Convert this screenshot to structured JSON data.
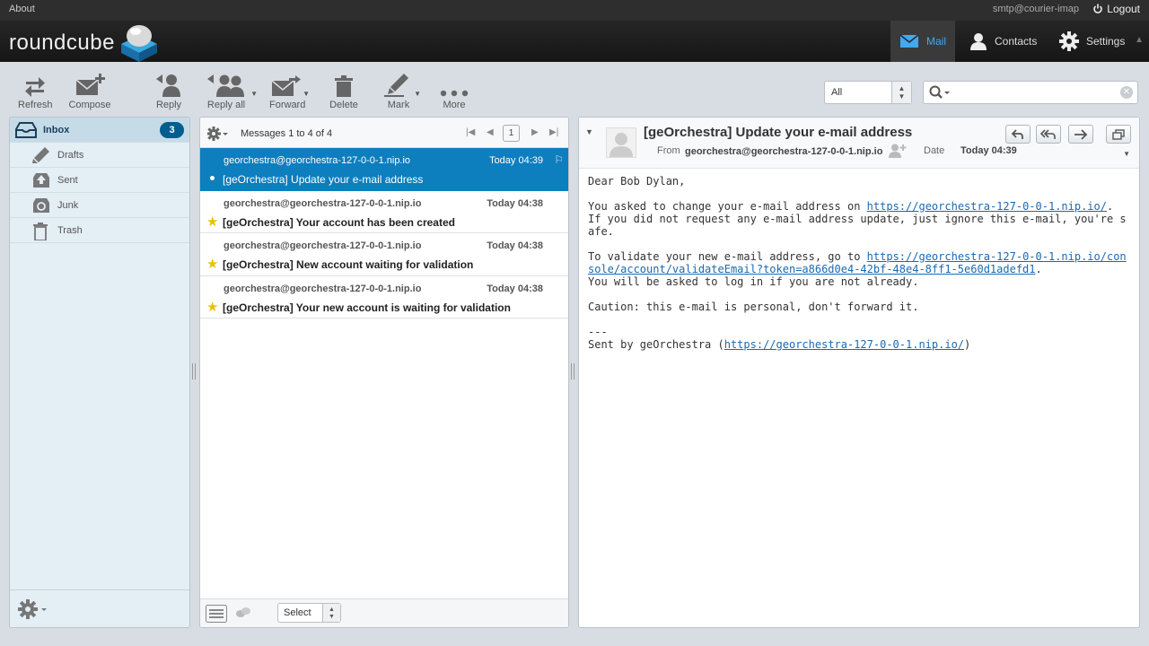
{
  "topline": {
    "about": "About",
    "user": "smtp@courier-imap",
    "logout": "Logout"
  },
  "header": {
    "logo": "roundcube",
    "nav": [
      {
        "label": "Mail",
        "icon": "mail-icon",
        "active": true
      },
      {
        "label": "Contacts",
        "icon": "contacts-icon"
      },
      {
        "label": "Settings",
        "icon": "gear-icon"
      }
    ]
  },
  "toolbar": {
    "refresh": "Refresh",
    "compose": "Compose",
    "reply": "Reply",
    "reply_all": "Reply all",
    "forward": "Forward",
    "delete": "Delete",
    "mark": "Mark",
    "more": "More"
  },
  "filter": {
    "value": "All"
  },
  "search": {
    "value": ""
  },
  "folders": [
    {
      "label": "Inbox",
      "icon": "inbox-icon",
      "unread": "3"
    },
    {
      "label": "Drafts",
      "icon": "drafts-icon"
    },
    {
      "label": "Sent",
      "icon": "sent-icon"
    },
    {
      "label": "Junk",
      "icon": "junk-icon"
    },
    {
      "label": "Trash",
      "icon": "trash-icon"
    }
  ],
  "messagelist": {
    "count": "Messages 1 to 4 of 4",
    "page": "1",
    "select_label": "Select",
    "messages": [
      {
        "from": "georchestra@georchestra-127-0-0-1.nip.io",
        "date": "Today 04:39",
        "subject": "[geOrchestra] Update your e-mail address",
        "selected": true,
        "flagged": false
      },
      {
        "from": "georchestra@georchestra-127-0-0-1.nip.io",
        "date": "Today 04:38",
        "subject": "[geOrchestra] Your account has been created",
        "flagged": true
      },
      {
        "from": "georchestra@georchestra-127-0-0-1.nip.io",
        "date": "Today 04:38",
        "subject": "[geOrchestra] New account waiting for validation",
        "flagged": true
      },
      {
        "from": "georchestra@georchestra-127-0-0-1.nip.io",
        "date": "Today 04:38",
        "subject": "[geOrchestra] Your new account is waiting for validation",
        "flagged": true
      }
    ]
  },
  "preview": {
    "subject": "[geOrchestra] Update your e-mail address",
    "from_label": "From",
    "from": "georchestra@georchestra-127-0-0-1.nip.io",
    "date_label": "Date",
    "date": "Today 04:39",
    "body": {
      "greeting": "Dear Bob Dylan,",
      "p1_start": "You asked to change your e-mail address on ",
      "p1_link": "https://georchestra-127-0-0-1.nip.io/",
      "p1_end": ".\nIf you did not request any e-mail address update, just ignore this e-mail, you're safe.",
      "p2_start": "To validate your new e-mail address, go to ",
      "p2_link": "https://georchestra-127-0-0-1.nip.io/console/account/validateEmail?token=a866d0e4-42bf-48e4-8ff1-5e60d1adefd1",
      "p2_end": ".\nYou will be asked to log in if you are not already.",
      "p3": "Caution: this e-mail is personal, don't forward it.",
      "sig_sep": "---",
      "sig_start": "Sent by geOrchestra (",
      "sig_link": "https://georchestra-127-0-0-1.nip.io/",
      "sig_end": ")"
    }
  }
}
